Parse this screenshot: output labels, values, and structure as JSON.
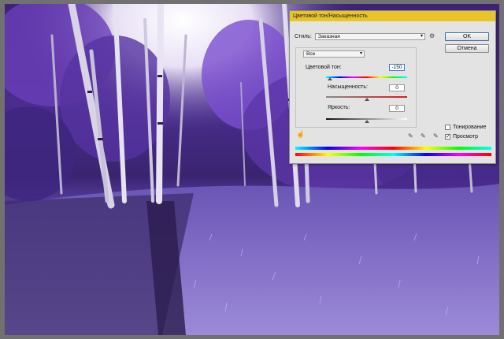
{
  "dialog": {
    "title": "Цветовой тон/Насыщенность",
    "style_label": "Стиль:",
    "style_value": "Заказная",
    "channel_value": "Все",
    "ok_label": "OK",
    "cancel_label": "Отмена",
    "hue_label": "Цветовой тон:",
    "hue_value": "-150",
    "saturation_label": "Насыщенность:",
    "saturation_value": "0",
    "lightness_label": "Яркость:",
    "lightness_value": "0",
    "colorize_label": "Тонирование",
    "colorize_checked": false,
    "preview_label": "Просмотр",
    "preview_checked": true,
    "accent_color": "#e8c427"
  },
  "icons": [
    "gear-icon",
    "hand-tool-icon",
    "eyedropper-icon",
    "eyedropper-plus-icon",
    "eyedropper-minus-icon",
    "chevron-down-icon"
  ]
}
